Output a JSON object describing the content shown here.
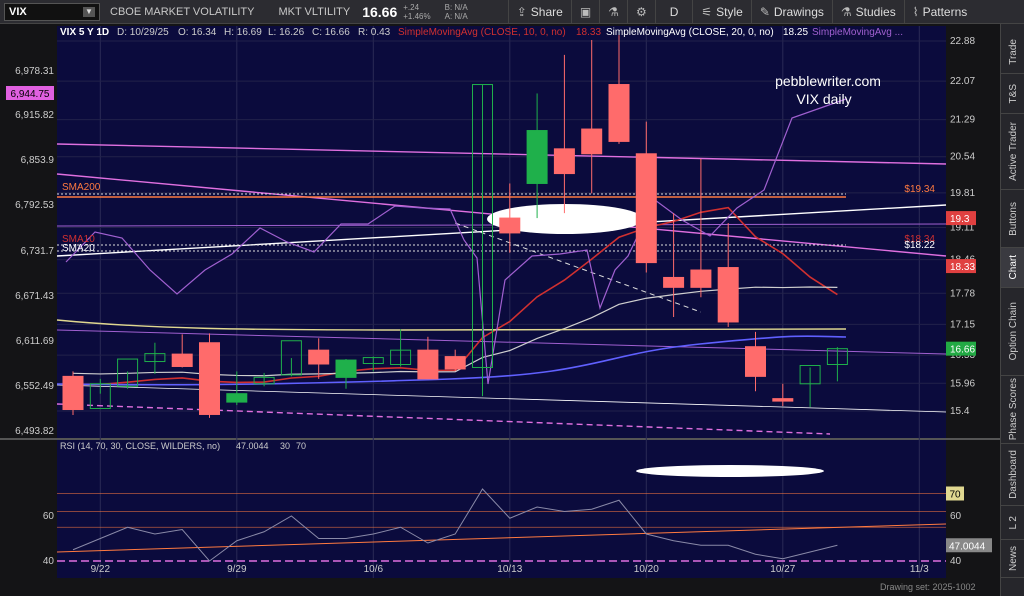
{
  "toolbar": {
    "symbol": "VIX",
    "name": "CBOE MARKET VOLATILITY",
    "short": "MKT VLTILITY",
    "price": "16.66",
    "change": "+.24",
    "change_pct": "+1.46%",
    "bid": "B: N/A",
    "ask": "A: N/A",
    "share": "Share",
    "period": "D",
    "style": "Style",
    "drawings": "Drawings",
    "studies": "Studies",
    "patterns": "Patterns"
  },
  "sidebar": [
    "Trade",
    "T&S",
    "Active Trader",
    "Buttons",
    "Chart",
    "Option Chain",
    "Phase Scores",
    "Dashboard",
    "L 2",
    "News"
  ],
  "header": {
    "symbol": "VIX 5 Y 1D",
    "date": "D: 10/29/25",
    "open": "O: 16.34",
    "high": "H: 16.69",
    "low": "L: 16.26",
    "close": "C: 16.66",
    "range": "R: 0.43",
    "sma10": "SimpleMovingAvg (CLOSE, 10, 0, no)",
    "sma10_val": "18.33",
    "sma20": "SimpleMovingAvg (CLOSE, 20, 0, no)",
    "sma20_val": "18.25",
    "sma_more": "SimpleMovingAvg ..."
  },
  "annotation": [
    "pebblewriter.com",
    "VIX daily"
  ],
  "rsi_header": {
    "label": "RSI (14, 70, 30, CLOSE, WILDERS, no)",
    "value": "47.0044",
    "ob": "30",
    "os": "70"
  },
  "colors": {
    "bg": "#0b0b3d",
    "up": "#1fb04b",
    "down": "#ff6b6b",
    "sma10": "#d03030",
    "sma20": "#cfcfcf",
    "sma200": "#ff7a40",
    "lilac": "#a060d0",
    "magenta": "#e070e0",
    "blue": "#6060ff",
    "yellow": "#e0d890",
    "white": "#ffffff"
  },
  "chart_data": {
    "type": "candlestick",
    "x": [
      "9/19",
      "9/22",
      "9/23",
      "9/24",
      "9/25",
      "9/26",
      "9/29",
      "9/30",
      "10/1",
      "10/2",
      "10/3",
      "10/6",
      "10/7",
      "10/8",
      "10/9",
      "10/10",
      "10/13",
      "10/14",
      "10/15",
      "10/16",
      "10/17",
      "10/20",
      "10/21",
      "10/22",
      "10/23",
      "10/24",
      "10/27",
      "10/28",
      "10/29"
    ],
    "open": [
      16.1,
      15.45,
      15.9,
      16.4,
      16.55,
      16.78,
      15.58,
      15.95,
      16.13,
      16.63,
      16.08,
      16.36,
      16.34,
      16.63,
      16.5,
      16.28,
      19.3,
      20.0,
      20.7,
      21.1,
      22.0,
      20.6,
      18.1,
      18.25,
      18.3,
      16.7,
      15.65,
      15.95,
      16.34
    ],
    "high": [
      16.2,
      16.05,
      16.2,
      16.78,
      16.95,
      16.97,
      16.2,
      16.17,
      16.47,
      16.87,
      16.45,
      16.5,
      17.05,
      16.9,
      16.64,
      22.0,
      20.0,
      21.82,
      22.6,
      22.9,
      23.0,
      21.25,
      19.4,
      20.5,
      19.2,
      17.0,
      15.95,
      16.28,
      16.69
    ],
    "low": [
      15.32,
      15.75,
      15.85,
      16.15,
      16.28,
      15.26,
      15.52,
      15.9,
      16.1,
      16.05,
      15.85,
      16.2,
      16.3,
      16.18,
      16.21,
      15.7,
      18.6,
      19.3,
      19.4,
      19.8,
      20.8,
      18.2,
      17.3,
      17.7,
      17.1,
      15.8,
      15.5,
      15.48,
      16.0
    ],
    "close": [
      15.43,
      15.95,
      16.45,
      16.56,
      16.3,
      15.33,
      15.75,
      16.08,
      16.82,
      16.35,
      16.43,
      16.48,
      16.63,
      16.05,
      16.25,
      22.0,
      19.0,
      21.07,
      20.2,
      20.6,
      20.85,
      18.4,
      17.9,
      17.9,
      17.2,
      16.1,
      15.6,
      16.32,
      16.66
    ],
    "y2_ticks": [
      15.4,
      15.96,
      16.53,
      17.15,
      17.78,
      18.46,
      19.11,
      19.81,
      20.54,
      21.29,
      22.07,
      22.88
    ],
    "y1_ticks": [
      "6,978.31",
      "6,915.82",
      "6,853.9",
      "6,792.53",
      "6,731.7",
      "6,671.43",
      "6,611.69",
      "6,552.49",
      "6,493.82"
    ],
    "x_ticks": [
      "9/22",
      "9/29",
      "10/6",
      "10/13",
      "10/20",
      "10/27",
      "11/3"
    ],
    "badges": {
      "spx": "6,944.75",
      "sma200_left": "SMA200",
      "sma10_left": "SMA10",
      "sma20_left": "SMA20",
      "sma200_right": "$19.34",
      "sma10_right": "$18.34",
      "sma20_right": "$18.22",
      "r1": "19.3",
      "r2": "18.33",
      "r3": "16.66"
    },
    "rsi_ticks": [
      "60",
      "40"
    ],
    "rsi_badges": {
      "ob": "70",
      "cur": "47.0044"
    },
    "rsi_values": [
      45,
      50,
      55,
      52,
      54,
      40,
      49,
      53,
      60,
      50,
      50,
      52,
      55,
      48,
      52,
      72,
      59,
      64,
      62,
      63,
      67,
      52,
      49,
      47,
      47,
      43,
      41,
      44,
      47
    ],
    "footer": "Drawing set: 2025-1002"
  }
}
